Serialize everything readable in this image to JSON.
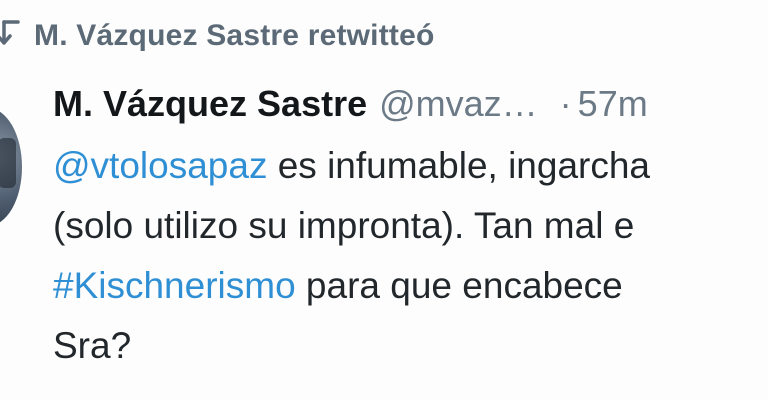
{
  "retweet": {
    "icon": "retweet-icon",
    "text": "M. Vázquez Sastre retwitteó"
  },
  "author": {
    "avatar": "avatar",
    "display_name": "M. Vázquez Sastre",
    "handle": "@mvaz…",
    "separator": "·",
    "time": "57m"
  },
  "tweet": {
    "mention": "@vtolosapaz",
    "line1_rest": " es infumable, ingarcha",
    "line2": "(solo utilizo su impronta). Tan mal e",
    "hashtag": "#Kischnerismo",
    "line3_rest": " para que encabece",
    "line4": "Sra?"
  },
  "colors": {
    "link": "#2f8fd4",
    "muted": "#6b7a86",
    "text": "#14171a"
  }
}
